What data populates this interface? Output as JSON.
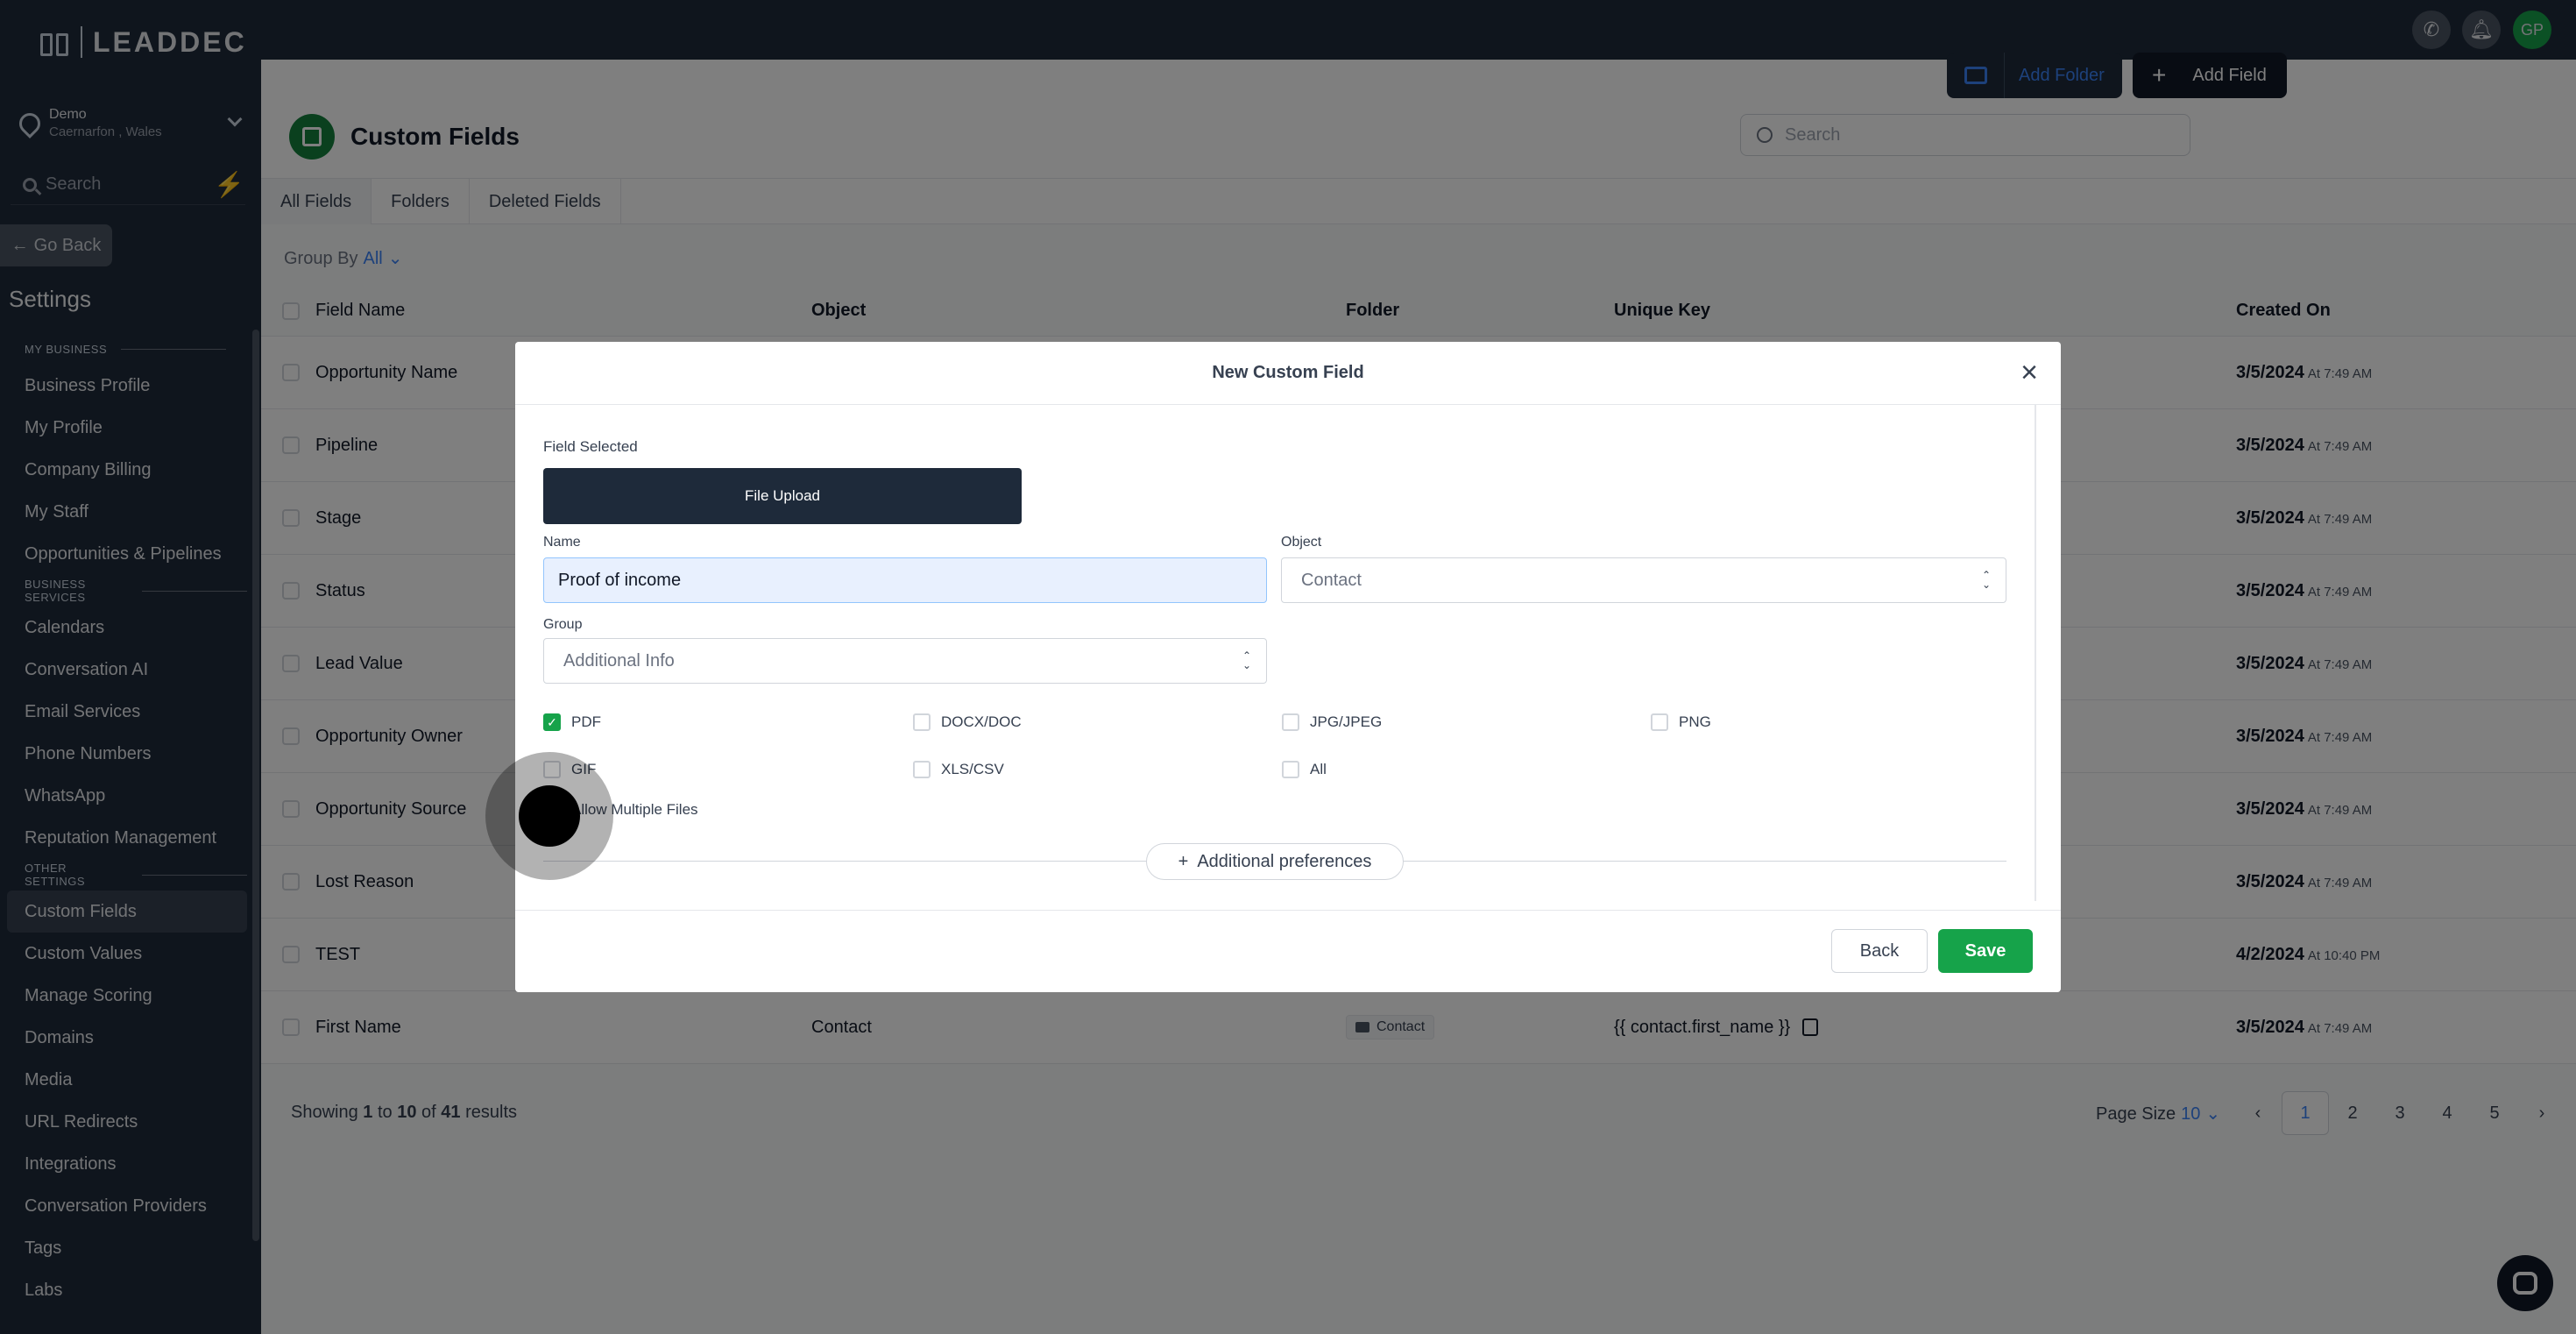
{
  "brand": {
    "name": "LEADDEC"
  },
  "location": {
    "name": "Demo",
    "address": "Caernarfon , Wales"
  },
  "sidebar": {
    "search_placeholder": "Search",
    "go_back": "Go Back",
    "settings_title": "Settings",
    "sections": [
      {
        "title": "MY BUSINESS",
        "items": [
          "Business Profile",
          "My Profile",
          "Company Billing",
          "My Staff",
          "Opportunities & Pipelines"
        ]
      },
      {
        "title": "BUSINESS SERVICES",
        "items": [
          "Calendars",
          "Conversation AI",
          "Email Services",
          "Phone Numbers",
          "WhatsApp",
          "Reputation Management"
        ]
      },
      {
        "title": "OTHER SETTINGS",
        "items": [
          "Custom Fields",
          "Custom Values",
          "Manage Scoring",
          "Domains",
          "Media",
          "URL Redirects",
          "Integrations",
          "Conversation Providers",
          "Tags",
          "Labs"
        ]
      }
    ],
    "active_item": "Custom Fields"
  },
  "topbar": {
    "avatar_initials": "GP",
    "icons": [
      "phone-icon",
      "bell-icon",
      "avatar"
    ]
  },
  "header": {
    "title": "Custom Fields",
    "search_placeholder": "Search",
    "add_folder": "Add Folder",
    "add_field": "Add Field"
  },
  "tabs": [
    "All Fields",
    "Folders",
    "Deleted Fields"
  ],
  "group_by": {
    "label": "Group By",
    "value": "All"
  },
  "table": {
    "columns": [
      "Field Name",
      "Object",
      "Folder",
      "Unique Key",
      "Created On"
    ],
    "rows": [
      {
        "name": "Opportunity Name",
        "object": "",
        "folder": "",
        "key": "",
        "date": "3/5/2024",
        "time": "At 7:49 AM"
      },
      {
        "name": "Pipeline",
        "object": "",
        "folder": "",
        "key": "",
        "date": "3/5/2024",
        "time": "At 7:49 AM"
      },
      {
        "name": "Stage",
        "object": "",
        "folder": "",
        "key": "",
        "date": "3/5/2024",
        "time": "At 7:49 AM"
      },
      {
        "name": "Status",
        "object": "",
        "folder": "",
        "key": "",
        "date": "3/5/2024",
        "time": "At 7:49 AM"
      },
      {
        "name": "Lead Value",
        "object": "",
        "folder": "",
        "key": "",
        "date": "3/5/2024",
        "time": "At 7:49 AM"
      },
      {
        "name": "Opportunity Owner",
        "object": "",
        "folder": "",
        "key": "",
        "date": "3/5/2024",
        "time": "At 7:49 AM"
      },
      {
        "name": "Opportunity Source",
        "object": "",
        "folder": "",
        "key": "",
        "date": "3/5/2024",
        "time": "At 7:49 AM"
      },
      {
        "name": "Lost Reason",
        "object": "",
        "folder": "",
        "key": "",
        "date": "3/5/2024",
        "time": "At 7:49 AM"
      },
      {
        "name": "TEST",
        "object": "",
        "folder": "",
        "key": "",
        "date": "4/2/2024",
        "time": "At 10:40 PM"
      },
      {
        "name": "First Name",
        "object": "Contact",
        "folder": "Contact",
        "key": "{{ contact.first_name }}",
        "date": "3/5/2024",
        "time": "At 7:49 AM"
      }
    ]
  },
  "footer": {
    "showing_prefix": "Showing",
    "from": "1",
    "to_word": "to",
    "to": "10",
    "of_word": "of",
    "total": "41",
    "results_word": "results",
    "page_size_label": "Page Size",
    "page_size": "10",
    "pages": [
      "1",
      "2",
      "3",
      "4",
      "5"
    ],
    "current_page": "1"
  },
  "modal": {
    "title": "New Custom Field",
    "field_selected_label": "Field Selected",
    "field_type": "File Upload",
    "name_label": "Name",
    "name_value": "Proof of income",
    "object_label": "Object",
    "object_value": "Contact",
    "group_label": "Group",
    "group_value": "Additional Info",
    "file_types": [
      {
        "label": "PDF",
        "checked": true
      },
      {
        "label": "DOCX/DOC",
        "checked": false
      },
      {
        "label": "JPG/JPEG",
        "checked": false
      },
      {
        "label": "PNG",
        "checked": false
      },
      {
        "label": "GIF",
        "checked": false
      },
      {
        "label": "XLS/CSV",
        "checked": false
      },
      {
        "label": "All",
        "checked": false
      }
    ],
    "allow_multiple": "Allow Multiple Files",
    "allow_multiple_checked": false,
    "additional_preferences": "Additional preferences",
    "back": "Back",
    "save": "Save"
  },
  "colors": {
    "accent_green": "#16a34a",
    "link_blue": "#3b82f6",
    "navy": "#1e2a3a"
  }
}
